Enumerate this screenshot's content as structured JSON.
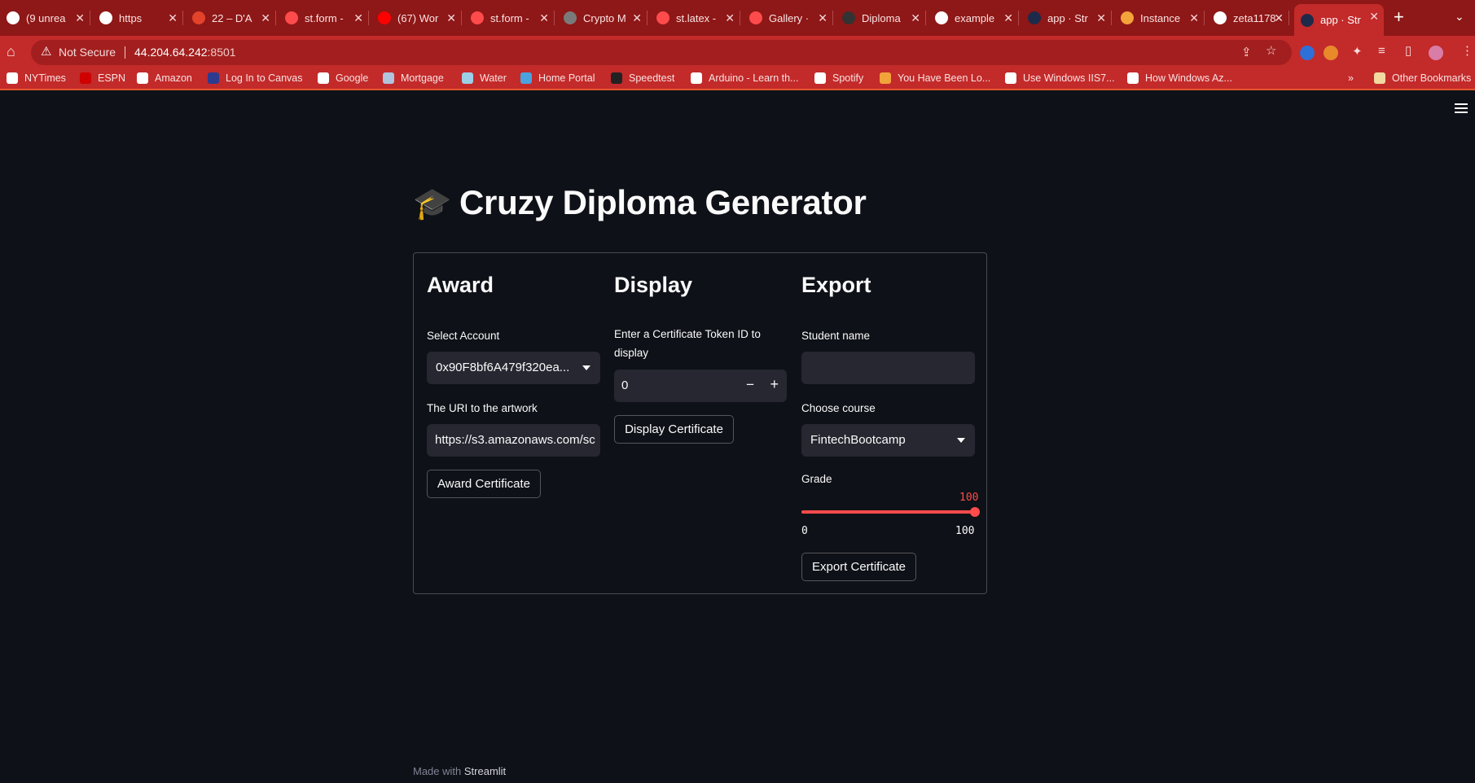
{
  "browser": {
    "tabs": [
      {
        "title": "(9 unrea",
        "favicon_color": "#ffffff"
      },
      {
        "title": "https",
        "favicon_color": "#ffffff"
      },
      {
        "title": "22 – D'A",
        "favicon_color": "#e2432a"
      },
      {
        "title": "st.form -",
        "favicon_color": "#ff4b4b"
      },
      {
        "title": "(67) Wor",
        "favicon_color": "#ff0000"
      },
      {
        "title": "st.form -",
        "favicon_color": "#ff4b4b"
      },
      {
        "title": "Crypto M",
        "favicon_color": "#7a7a7a"
      },
      {
        "title": "st.latex -",
        "favicon_color": "#ff4b4b"
      },
      {
        "title": "Gallery ·",
        "favicon_color": "#ff4b4b"
      },
      {
        "title": "Diploma",
        "favicon_color": "#333333"
      },
      {
        "title": "example",
        "favicon_color": "#ffffff"
      },
      {
        "title": "app · Str",
        "favicon_color": "#1e2a4a"
      },
      {
        "title": "Instance",
        "favicon_color": "#f2a33a"
      },
      {
        "title": "zeta1178",
        "favicon_color": "#ffffff"
      },
      {
        "title": "app · Str",
        "favicon_color": "#1e2a4a"
      }
    ],
    "active_tab_index": 14,
    "new_tab_label": "+",
    "security_label": "Not Secure",
    "url_host": "44.204.64.242",
    "url_port": ":8501",
    "bookmarks": [
      {
        "label": "NYTimes",
        "icon_color": "#ffffff"
      },
      {
        "label": "ESPN",
        "icon_color": "#d00000"
      },
      {
        "label": "Amazon",
        "icon_color": "#ffffff"
      },
      {
        "label": "Log In to Canvas",
        "icon_color": "#2d3b8f"
      },
      {
        "label": "Google",
        "icon_color": "#ffffff"
      },
      {
        "label": "Mortgage",
        "icon_color": "#b0c4de"
      },
      {
        "label": "Water",
        "icon_color": "#9ccfe8"
      },
      {
        "label": "Home Portal",
        "icon_color": "#4aa3df"
      },
      {
        "label": "Speedtest",
        "icon_color": "#222222"
      },
      {
        "label": "Arduino - Learn th...",
        "icon_color": "#ffffff"
      },
      {
        "label": "Spotify",
        "icon_color": "#ffffff"
      },
      {
        "label": "You Have Been Lo...",
        "icon_color": "#f2a33a"
      },
      {
        "label": "Use Windows IIS7...",
        "icon_color": "#ffffff"
      },
      {
        "label": "How Windows Az...",
        "icon_color": "#ffffff"
      }
    ],
    "more_bookmarks": "»",
    "other_bookmarks": "Other Bookmarks"
  },
  "app": {
    "title": "Cruzy Diploma Generator",
    "title_emoji": "🎓",
    "award": {
      "heading": "Award",
      "account_label": "Select Account",
      "account_value": "0x90F8bf6A479f320ea...",
      "uri_label": "The URI to the artwork",
      "uri_value": "https://s3.amazonaws.com/sc",
      "button": "Award Certificate"
    },
    "display": {
      "heading": "Display",
      "token_label": "Enter a Certificate Token ID to display",
      "token_value": "0",
      "minus": "−",
      "plus": "+",
      "button": "Display Certificate"
    },
    "export": {
      "heading": "Export",
      "student_label": "Student name",
      "student_value": "",
      "course_label": "Choose course",
      "course_value": "FintechBootcamp",
      "grade_label": "Grade",
      "grade_value": "100",
      "grade_min": "0",
      "grade_max": "100",
      "grade_fraction": 1.0,
      "button": "Export Certificate"
    },
    "footer_prefix": "Made with ",
    "footer_brand": "Streamlit"
  },
  "colors": {
    "accent": "#ff4b4b",
    "background": "#0e1117",
    "input_bg": "#262730",
    "browser_frame": "#c32a2a"
  }
}
